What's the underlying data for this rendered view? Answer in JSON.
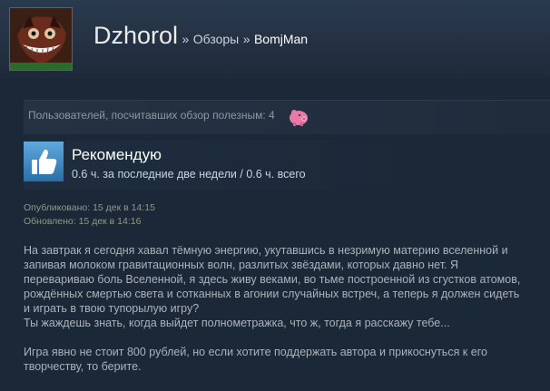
{
  "header": {
    "user_name": "Dzhorol",
    "separator_1": "»",
    "reviews_link": "Обзоры",
    "separator_2": "»",
    "game_link": "BomjMan"
  },
  "helpful": {
    "text": "Пользователей, посчитавших обзор полезным: 4",
    "award_icon": "pig-award-icon"
  },
  "recommendation": {
    "icon": "thumbs-up-icon",
    "title": "Рекомендую",
    "hours": "0.6 ч. за последние две недели / 0.6 ч. всего"
  },
  "dates": {
    "posted": "Опубликовано: 15 дек в 14:15",
    "updated": "Обновлено: 15 дек в 14:16"
  },
  "review": {
    "p1_l1": "На завтрак я сегодня хавал тёмную энергию, укутавшись в незримую материю вселенной и",
    "p1_l2": "запивая молоком гравитационных волн, разлитых звёздами, которых давно нет. Я",
    "p1_l3": "перевариваю боль Вселенной, я здесь живу веками, во тьме построенной из сгустков атомов,",
    "p1_l4": "рождённых смертью света и сотканных в агонии случайных встреч, а теперь я должен сидеть",
    "p1_l5": "и играть в твою тупорылую игру?",
    "p1_l6": "Ты жаждешь знать, когда выйдет полнометражка, что ж, тогда я расскажу тебе...",
    "p2_l1": "Игра явно не стоит 800 рублей, но если хотите поддержать автора и прикоснуться к его",
    "p2_l2": "творчеству, то берите."
  },
  "colors": {
    "background": "#1b2838",
    "header": "#2a3a4e",
    "thumb_blue": "#4a90c8",
    "pig_pink": "#e06a9a"
  }
}
